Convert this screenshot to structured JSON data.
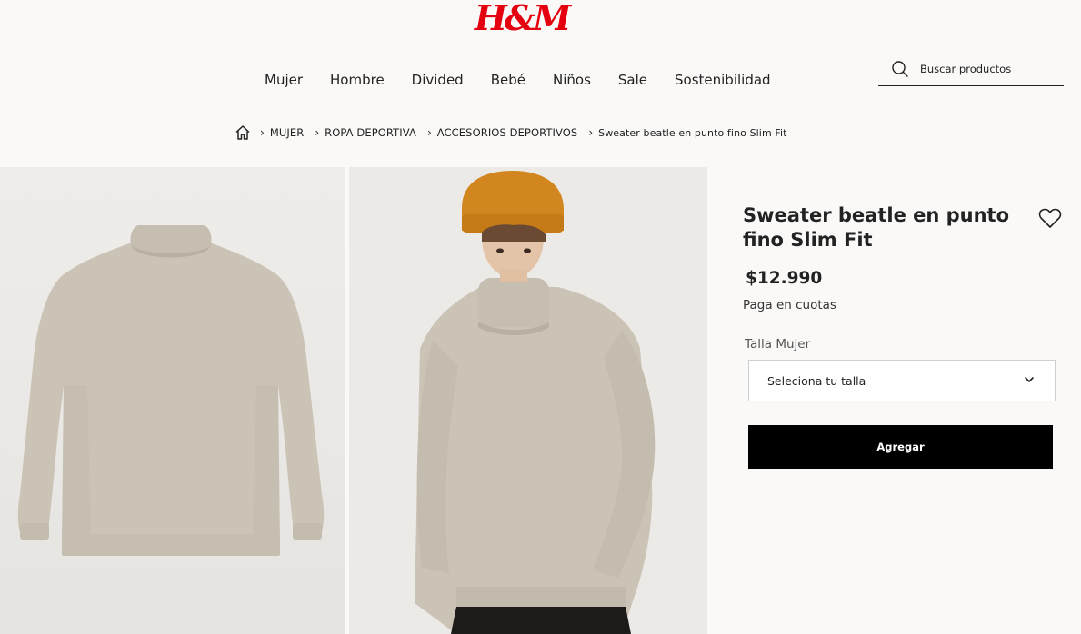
{
  "brand": {
    "logo_text": "H&M",
    "color": "#e50010"
  },
  "nav": {
    "items": [
      {
        "label": "Mujer"
      },
      {
        "label": "Hombre"
      },
      {
        "label": "Divided"
      },
      {
        "label": "Bebé"
      },
      {
        "label": "Niños"
      },
      {
        "label": "Sale"
      },
      {
        "label": "Sostenibilidad"
      }
    ]
  },
  "search": {
    "placeholder": "Buscar productos",
    "icon": "search-icon"
  },
  "breadcrumb": {
    "items": [
      "MUJER",
      "ROPA DEPORTIVA",
      "ACCESORIOS DEPORTIVOS",
      "Sweater beatle en punto fino Slim Fit"
    ]
  },
  "product": {
    "title": "Sweater beatle en punto fino Slim Fit",
    "price": "$12.990",
    "installments": "Paga en cuotas",
    "size_label": "Talla Mujer",
    "size_placeholder": "Seleciona tu talla",
    "add_label": "Agregar",
    "sweater_color": "#cbc3b6",
    "beanie_color": "#d2861f"
  }
}
